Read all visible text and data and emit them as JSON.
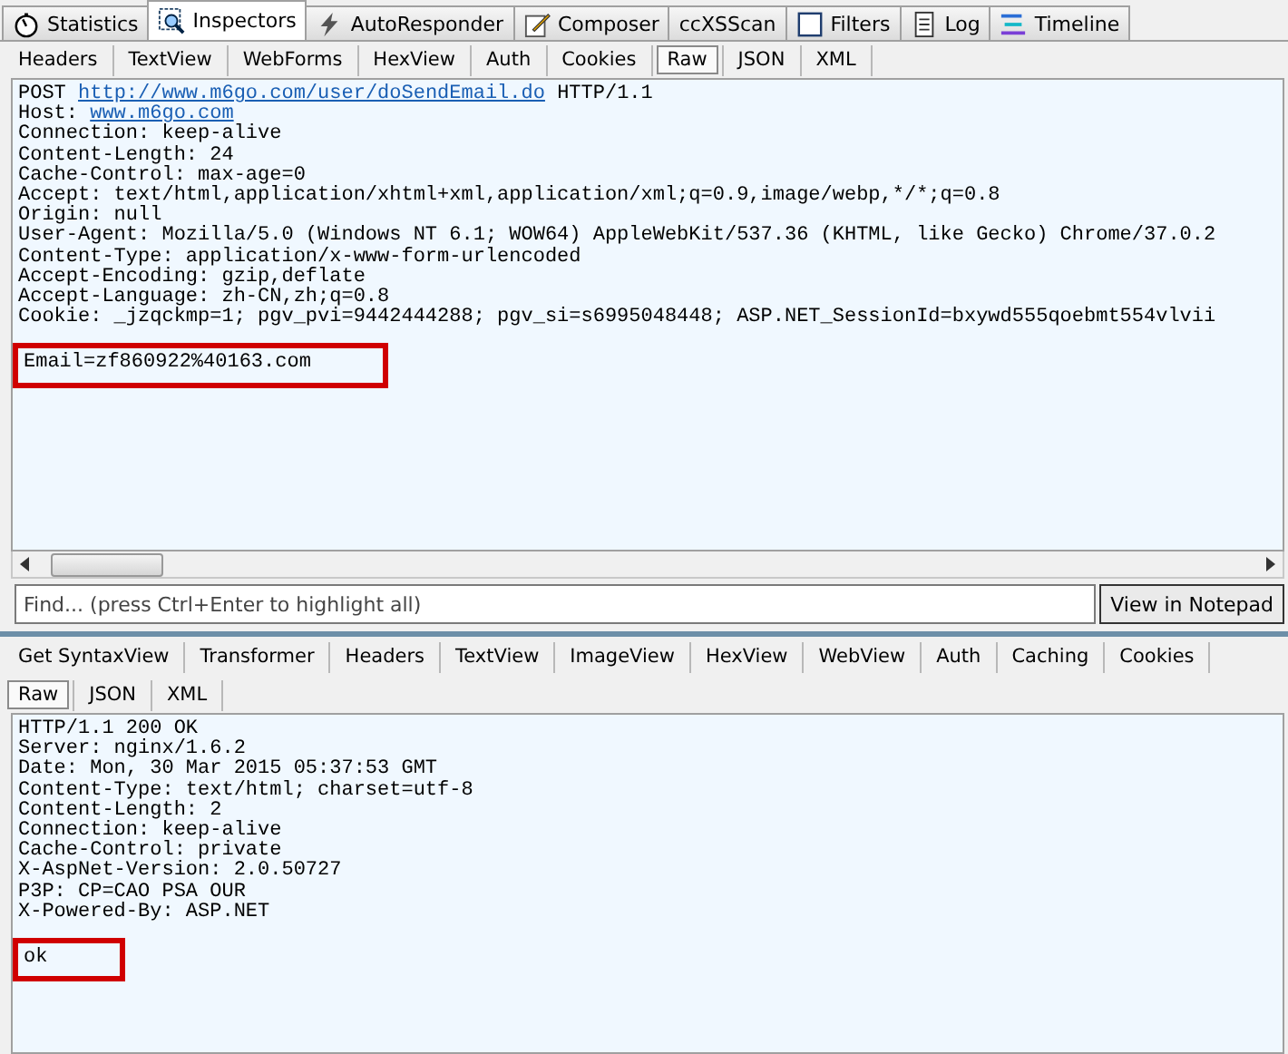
{
  "main_tabs": [
    {
      "label": "Statistics",
      "selected": false
    },
    {
      "label": "Inspectors",
      "selected": true
    },
    {
      "label": "AutoResponder",
      "selected": false
    },
    {
      "label": "Composer",
      "selected": false
    },
    {
      "label": "ccXSScan",
      "selected": false
    },
    {
      "label": "Filters",
      "selected": false
    },
    {
      "label": "Log",
      "selected": false
    },
    {
      "label": "Timeline",
      "selected": false
    }
  ],
  "request": {
    "tabs": [
      {
        "label": "Headers",
        "selected": false
      },
      {
        "label": "TextView",
        "selected": false
      },
      {
        "label": "WebForms",
        "selected": false
      },
      {
        "label": "HexView",
        "selected": false
      },
      {
        "label": "Auth",
        "selected": false
      },
      {
        "label": "Cookies",
        "selected": false
      },
      {
        "label": "Raw",
        "selected": true
      },
      {
        "label": "JSON",
        "selected": false
      },
      {
        "label": "XML",
        "selected": false
      }
    ],
    "lines": [
      [
        {
          "text": "POST "
        },
        {
          "text": "http://www.m6go.com/user/doSendEmail.do",
          "link": true
        },
        {
          "text": " HTTP/1.1"
        }
      ],
      [
        {
          "text": "Host: "
        },
        {
          "text": "www.m6go.com",
          "link": true
        }
      ],
      [
        {
          "text": "Connection: keep-alive"
        }
      ],
      [
        {
          "text": "Content-Length: 24"
        }
      ],
      [
        {
          "text": "Cache-Control: max-age=0"
        }
      ],
      [
        {
          "text": "Accept: text/html,application/xhtml+xml,application/xml;q=0.9,image/webp,*/*;q=0.8"
        }
      ],
      [
        {
          "text": "Origin: null"
        }
      ],
      [
        {
          "text": "User-Agent: Mozilla/5.0 (Windows NT 6.1; WOW64) AppleWebKit/537.36 (KHTML, like Gecko) Chrome/37.0.2"
        }
      ],
      [
        {
          "text": "Content-Type: application/x-www-form-urlencoded"
        }
      ],
      [
        {
          "text": "Accept-Encoding: gzip,deflate"
        }
      ],
      [
        {
          "text": "Accept-Language: zh-CN,zh;q=0.8"
        }
      ],
      [
        {
          "text": "Cookie: _jzqckmp=1; pgv_pvi=9442444288; pgv_si=s6995048448; ASP.NET_SessionId=bxywd555qoebmt554vlvii"
        }
      ]
    ],
    "body": {
      "text": "Email=zf860922%40163.com",
      "highlighted": true
    },
    "find": {
      "placeholder": "Find... (press Ctrl+Enter to highlight all)"
    },
    "notepad_button": "View in Notepad"
  },
  "response": {
    "tabs": [
      {
        "label": "Get SyntaxView",
        "selected": false
      },
      {
        "label": "Transformer",
        "selected": false
      },
      {
        "label": "Headers",
        "selected": false
      },
      {
        "label": "TextView",
        "selected": false
      },
      {
        "label": "ImageView",
        "selected": false
      },
      {
        "label": "HexView",
        "selected": false
      },
      {
        "label": "WebView",
        "selected": false
      },
      {
        "label": "Auth",
        "selected": false
      },
      {
        "label": "Caching",
        "selected": false
      },
      {
        "label": "Cookies",
        "selected": false
      }
    ],
    "subtabs": [
      {
        "label": "Raw",
        "selected": true
      },
      {
        "label": "JSON",
        "selected": false
      },
      {
        "label": "XML",
        "selected": false
      }
    ],
    "lines": [
      [
        {
          "text": "HTTP/1.1 200 OK"
        }
      ],
      [
        {
          "text": "Server: nginx/1.6.2"
        }
      ],
      [
        {
          "text": "Date: Mon, 30 Mar 2015 05:37:53 GMT"
        }
      ],
      [
        {
          "text": "Content-Type: text/html; charset=utf-8"
        }
      ],
      [
        {
          "text": "Content-Length: 2"
        }
      ],
      [
        {
          "text": "Connection: keep-alive"
        }
      ],
      [
        {
          "text": "Cache-Control: private"
        }
      ],
      [
        {
          "text": "X-AspNet-Version: 2.0.50727"
        }
      ],
      [
        {
          "text": "P3P: CP=CAO PSA OUR"
        }
      ],
      [
        {
          "text": "X-Powered-By: ASP.NET"
        }
      ]
    ],
    "body": {
      "text": "ok",
      "highlighted": true
    }
  }
}
